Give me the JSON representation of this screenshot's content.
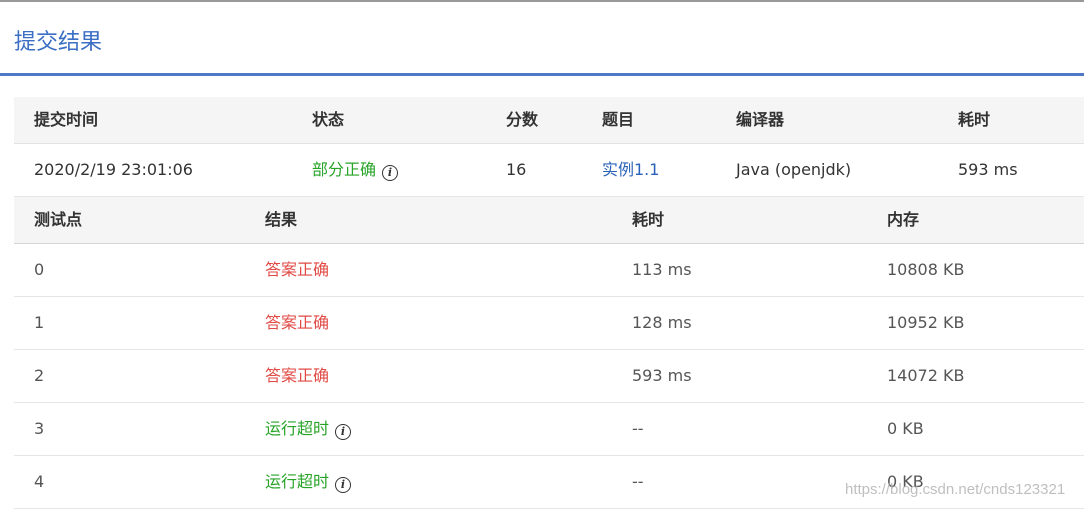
{
  "page": {
    "title": "提交结果"
  },
  "summary": {
    "headers": {
      "time": "提交时间",
      "status": "状态",
      "score": "分数",
      "problem": "题目",
      "compiler": "编译器",
      "elapsed": "耗时"
    },
    "row": {
      "time": "2020/2/19 23:01:06",
      "status": "部分正确",
      "score": "16",
      "problem": "实例1.1",
      "compiler": "Java (openjdk)",
      "elapsed": "593 ms"
    }
  },
  "details": {
    "headers": {
      "case": "测试点",
      "result": "结果",
      "elapsed": "耗时",
      "memory": "内存"
    },
    "rows": [
      {
        "case": "0",
        "result": "答案正确",
        "elapsed": "113 ms",
        "memory": "10808 KB"
      },
      {
        "case": "1",
        "result": "答案正确",
        "elapsed": "128 ms",
        "memory": "10952 KB"
      },
      {
        "case": "2",
        "result": "答案正确",
        "elapsed": "593 ms",
        "memory": "14072 KB"
      },
      {
        "case": "3",
        "result": "运行超时",
        "elapsed": "--",
        "memory": "0 KB"
      },
      {
        "case": "4",
        "result": "运行超时",
        "elapsed": "--",
        "memory": "0 KB"
      }
    ]
  },
  "watermark": "https://blog.csdn.net/cnds123321",
  "colors": {
    "accent": "#4d79c7",
    "success": "#28a428",
    "accepted": "#e14a45",
    "link": "#2a62b8"
  },
  "icons": {
    "info": "info-circle-icon"
  }
}
